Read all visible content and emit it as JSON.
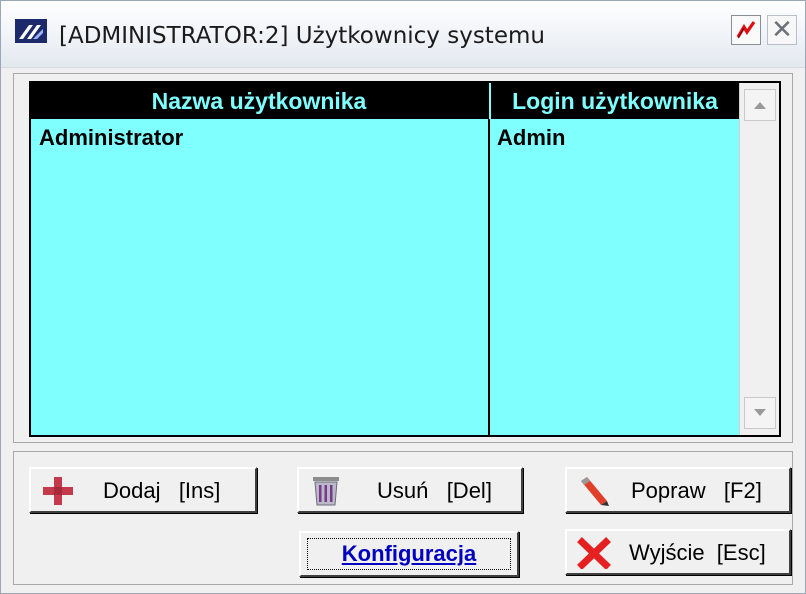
{
  "window": {
    "title": "[ADMINISTRATOR:2]  Użytkownicy systemu",
    "close_glyph": "✕",
    "icons": {
      "app": "app-logo-icon",
      "pin": "pin-icon",
      "close": "close-icon"
    }
  },
  "grid": {
    "columns": [
      "Nazwa użytkownika",
      "Login użytkownika"
    ],
    "rows": [
      {
        "name": "Administrator",
        "login": "Admin"
      }
    ],
    "colors": {
      "background": "#80ffff",
      "header_bg": "#000000",
      "header_text": "#80ffff"
    }
  },
  "buttons": {
    "add": {
      "label": "Dodaj   [Ins]",
      "icon": "plus-icon"
    },
    "delete": {
      "label": "Usuń   [Del]",
      "icon": "trash-icon"
    },
    "edit": {
      "label": "Popraw   [F2]",
      "icon": "pencil-icon"
    },
    "config": {
      "label": "Konfiguracja"
    },
    "exit": {
      "label": "Wyjście  [Esc]",
      "icon": "red-x-icon"
    }
  }
}
